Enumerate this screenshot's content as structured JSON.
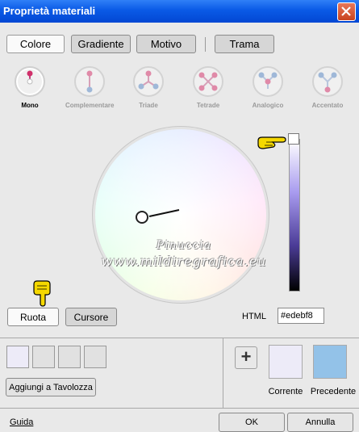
{
  "window": {
    "title": "Proprietà materiali"
  },
  "tabs": [
    {
      "label": "Colore",
      "active": true
    },
    {
      "label": "Gradiente",
      "active": false
    },
    {
      "label": "Motivo",
      "active": false
    },
    {
      "label": "Trama",
      "active": false
    }
  ],
  "schemes": [
    {
      "label": "Mono",
      "icon": "mono-scheme-icon",
      "active": true
    },
    {
      "label": "Complementare",
      "icon": "complementary-scheme-icon",
      "active": false
    },
    {
      "label": "Triade",
      "icon": "triad-scheme-icon",
      "active": false
    },
    {
      "label": "Tetrade",
      "icon": "tetrad-scheme-icon",
      "active": false
    },
    {
      "label": "Analogico",
      "icon": "analogous-scheme-icon",
      "active": false
    },
    {
      "label": "Accentato",
      "icon": "accented-scheme-icon",
      "active": false
    }
  ],
  "watermark": {
    "line1": "Pinuccia",
    "line2": "www.mildiregrafica.eu"
  },
  "mode_buttons": {
    "ruota": "Ruota",
    "cursore": "Cursore"
  },
  "html_field": {
    "label": "HTML",
    "value": "#edebf8"
  },
  "palette": {
    "add_label": "Aggiungi a Tavolozza"
  },
  "colors": {
    "current_label": "Corrente",
    "previous_label": "Precedente",
    "current": "#edebf8",
    "previous": "#93c2e8"
  },
  "footer": {
    "help": "Guida",
    "ok": "OK",
    "cancel": "Annulla"
  }
}
